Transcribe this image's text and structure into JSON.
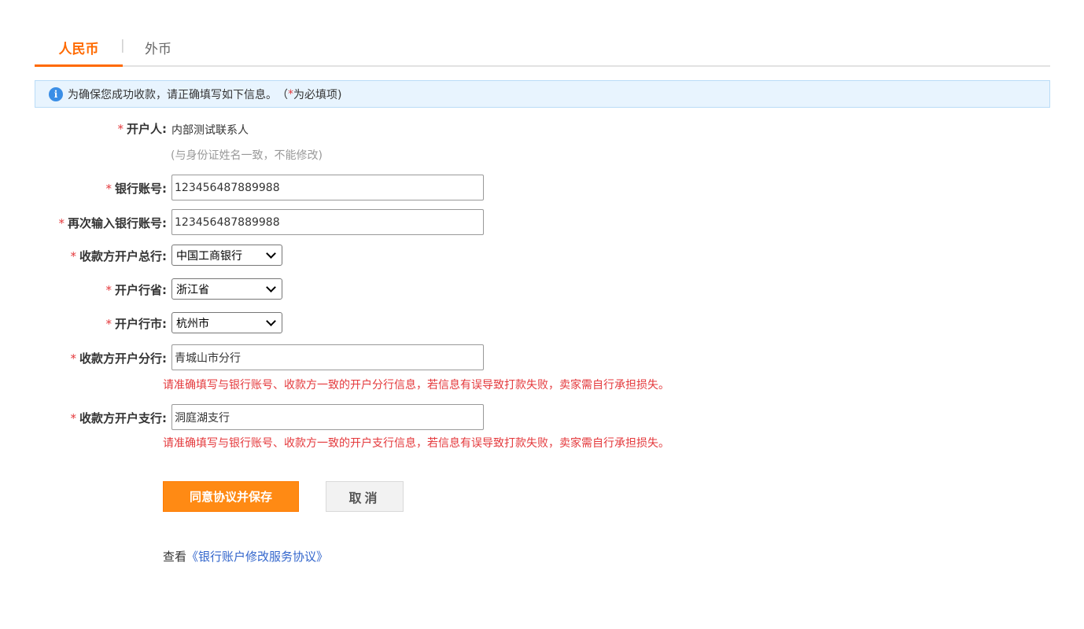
{
  "tabs": {
    "rmb": "人民币",
    "separator": "|",
    "foreign": "外币"
  },
  "notice": {
    "icon": "info-icon",
    "text": "为确保您成功收款，请正确填写如下信息。",
    "req_open": "（",
    "req_star": "*",
    "req_text": " 为必填项)"
  },
  "form": {
    "required_mark": "*",
    "account_holder": {
      "label": "开户人:",
      "value": "内部测试联系人",
      "hint": "(与身份证姓名一致，不能修改)"
    },
    "bank_account": {
      "label": "银行账号:",
      "value": "123456487889988"
    },
    "bank_account_confirm": {
      "label": "再次输入银行账号:",
      "value": "123456487889988"
    },
    "head_bank": {
      "label": "收款方开户总行:",
      "selected": "中国工商银行"
    },
    "province": {
      "label": "开户行省:",
      "selected": "浙江省"
    },
    "city": {
      "label": "开户行市:",
      "selected": "杭州市"
    },
    "branch": {
      "label": "收款方开户分行:",
      "value": "青城山市分行",
      "warning": "请准确填写与银行账号、收款方一致的开户分行信息，若信息有误导致打款失败，卖家需自行承担损失。"
    },
    "sub_branch": {
      "label": "收款方开户支行:",
      "value": "洞庭湖支行",
      "warning": "请准确填写与银行账号、收款方一致的开户支行信息，若信息有误导致打款失败，卖家需自行承担损失。"
    }
  },
  "actions": {
    "save": "同意协议并保存",
    "cancel": "取消"
  },
  "agreement": {
    "prefix": "查看",
    "link": "《银行账户修改服务协议》"
  },
  "colors": {
    "accent": "#ff6a00",
    "button": "#ff8a14",
    "required": "#e4393c",
    "link": "#3366cc",
    "notice_bg": "#e8f4fe"
  }
}
